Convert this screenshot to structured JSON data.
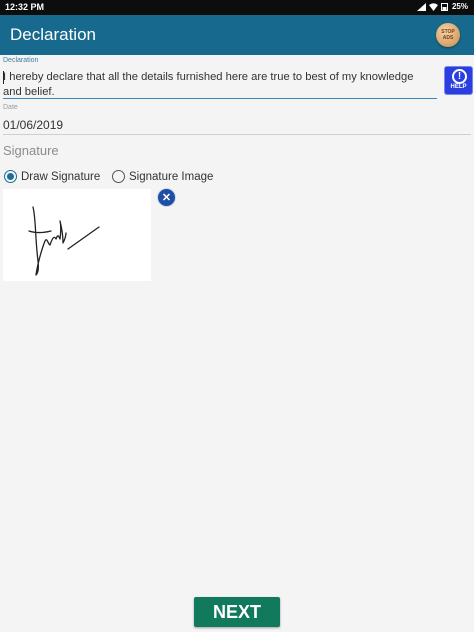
{
  "status_bar": {
    "time": "12:32 PM",
    "battery": "25%"
  },
  "app_bar": {
    "title": "Declaration",
    "stop_ads_line1": "STOP",
    "stop_ads_line2": "ADS"
  },
  "declaration": {
    "label": "Declaration",
    "value": "I hereby declare that all the details furnished here are true to best of my knowledge and belief."
  },
  "help": {
    "label": "HELP"
  },
  "date": {
    "label": "Date",
    "value": "01/06/2019"
  },
  "signature": {
    "heading": "Signature",
    "options": [
      {
        "label": "Draw Signature",
        "checked": true
      },
      {
        "label": "Signature Image",
        "checked": false
      }
    ]
  },
  "next": {
    "label": "NEXT"
  },
  "colors": {
    "app_bar": "#176a8d",
    "next_button": "#127a5c",
    "help_button": "#2b3fe0",
    "accent": "#3b87b8"
  }
}
